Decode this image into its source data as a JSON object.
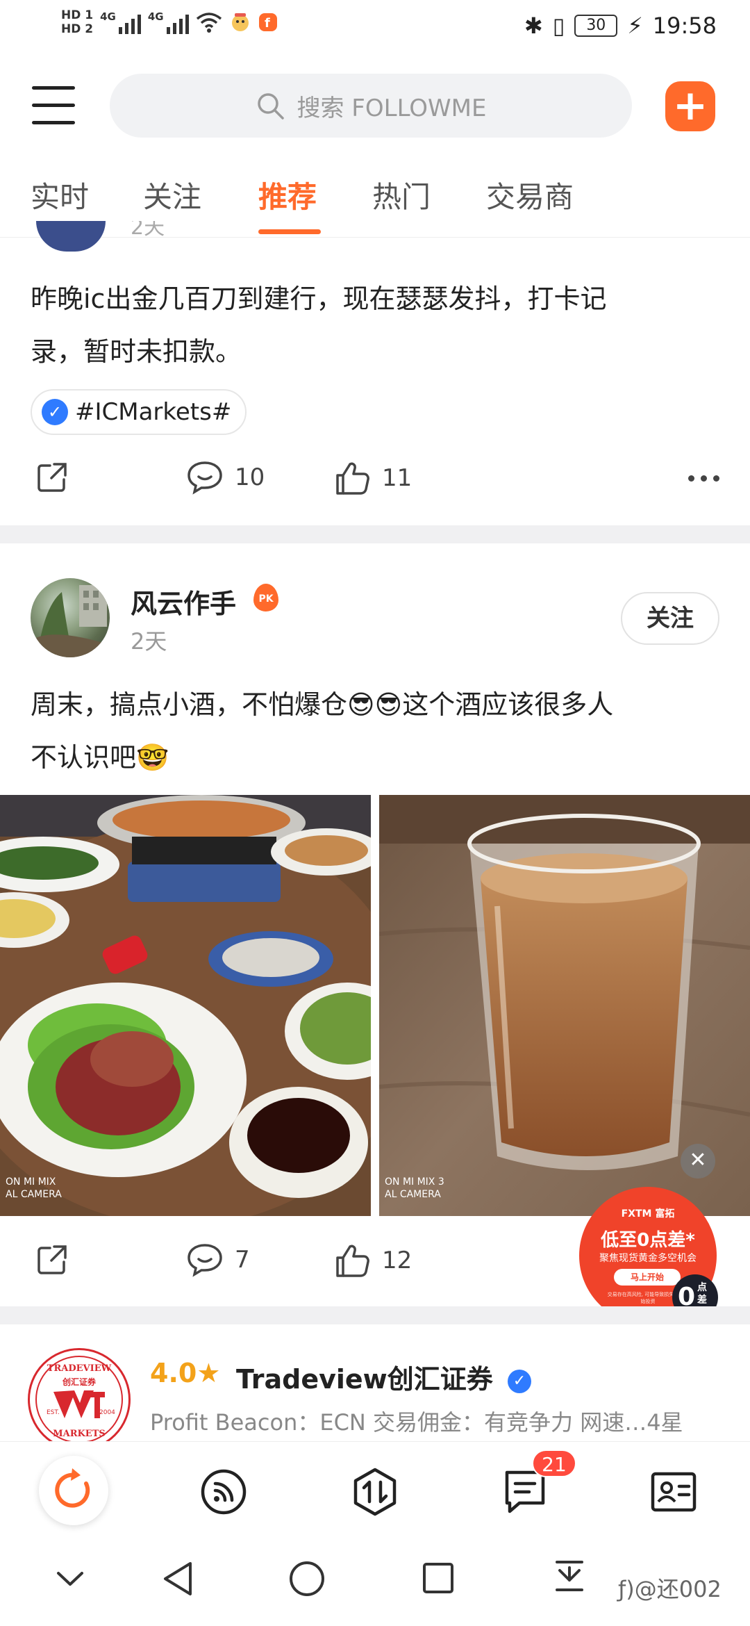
{
  "status_bar": {
    "hd1": "HD 1",
    "hd2": "HD 2",
    "net1": "4G",
    "net2": "4G",
    "battery": "30",
    "time": "19:58"
  },
  "top_bar": {
    "search_placeholder": "搜索 FOLLOWME",
    "add_label": "+"
  },
  "tabs": [
    {
      "label": "实时"
    },
    {
      "label": "关注"
    },
    {
      "label": "推荐",
      "active": true
    },
    {
      "label": "热门"
    },
    {
      "label": "交易商"
    }
  ],
  "post1": {
    "time_partial": "2天",
    "text_line1": "昨晚ic出金几百刀到建行，现在瑟瑟发抖，打卡记",
    "text_line2": "录，暂时未扣款。",
    "hashtag": "#ICMarkets#",
    "comments": "10",
    "likes": "11"
  },
  "post2": {
    "author": "风云作手",
    "badge": "PK",
    "time": "2天",
    "follow_label": "关注",
    "text_line1": "周末，搞点小酒，不怕爆仓😎😎这个酒应该很多人",
    "text_line2": "不认识吧🤓",
    "photo1_caption_line1": "ON MI MIX",
    "photo1_caption_line2": "AL CAMERA",
    "photo2_caption_line1": "ON MI MIX 3",
    "photo2_caption_line2": "AL CAMERA",
    "comments": "7",
    "likes": "12"
  },
  "ad": {
    "brand": "FXTM 富拓",
    "title": "低至0点差*",
    "subtitle": "聚焦现货黄金多空机会",
    "button": "马上开始",
    "fine_print": "交易存在高风险, 可能导致损失超过初始投资",
    "zero": "0",
    "zero_label": "点差"
  },
  "broker": {
    "logo_top": "TRADEVIEW",
    "logo_mid": "创汇证券",
    "logo_bottom": "MARKETS",
    "logo_est": "EST.",
    "logo_year": "2004",
    "rating": "4.0",
    "name": "Tradeview创汇证券",
    "desc": "Profit Beacon：ECN 交易佣金：有竞争力 网速…4星"
  },
  "bottom_nav": {
    "messages_badge": "21"
  },
  "watermark": "ƒ)@还002",
  "colors": {
    "accent": "#ff6a2b",
    "verified": "#2f7bff",
    "ad": "#f0432a",
    "badge": "#ff4a3d"
  }
}
